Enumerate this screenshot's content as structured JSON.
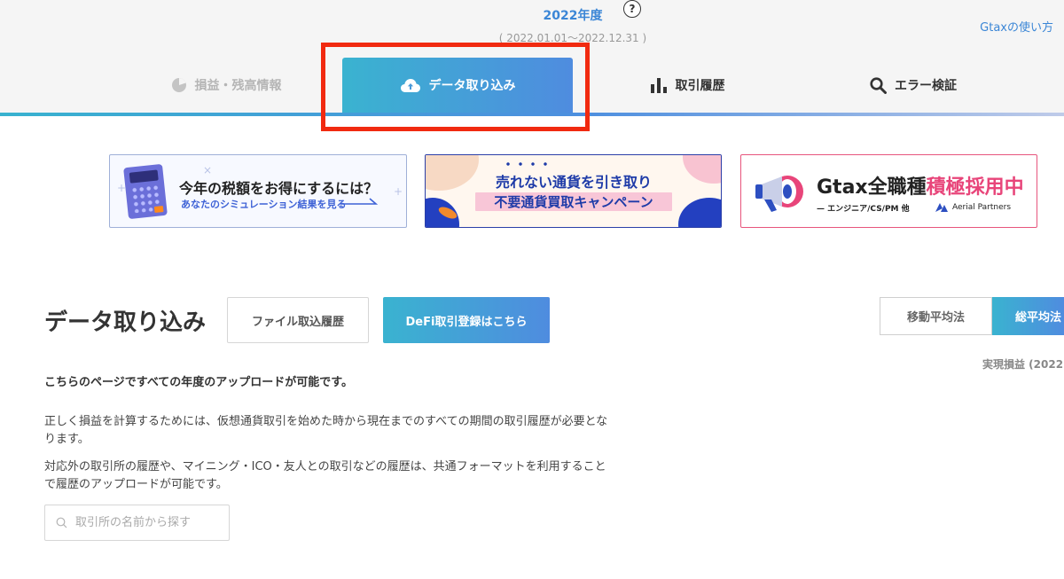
{
  "header": {
    "year_title": "2022年度",
    "year_range": "( 2022.01.01〜2022.12.31 )",
    "help_icon_glyph": "?",
    "guide_link": "Gtaxの使い方"
  },
  "nav_tabs": [
    {
      "label": "損益・残高情報",
      "icon": "pie-chart-icon",
      "active": false
    },
    {
      "label": "データ取り込み",
      "icon": "cloud-upload-icon",
      "active": true
    },
    {
      "label": "取引履歴",
      "icon": "bar-chart-icon",
      "active": false
    },
    {
      "label": "エラー検証",
      "icon": "search-icon",
      "active": false
    }
  ],
  "banners": {
    "tax": {
      "title": "今年の税額をお得にするには？",
      "subtitle": "あなたのシミュレーション結果を見る",
      "calc_key": "AC"
    },
    "campaign": {
      "title": "売れない通貨を引き取り",
      "subtitle": "不要通貨買取キャンペーン"
    },
    "recruit": {
      "brand": "Gtax",
      "title_plain": "全職種",
      "title_accent": "積極採用中",
      "subtitle": "— エンジニア/CS/PM 他",
      "partner": "Aerial Partners"
    }
  },
  "main": {
    "page_title": "データ取り込み",
    "history_button": "ファイル取込履歴",
    "defi_button": "DeFi取引登録はこちら",
    "methods": {
      "moving_average": "移動平均法",
      "total_average": "総平均法"
    },
    "realized_label": "実現損益 (2022",
    "lead": "こちらのページですべての年度のアップロードが可能です。",
    "para1": "正しく損益を計算するためには、仮想通貨取引を始めた時から現在までのすべての期間の取引履歴が必要となります。",
    "para2": "対応外の取引所の履歴や、マイニング・ICO・友人との取引などの履歴は、共通フォーマットを利用することで履歴のアップロードが可能です。",
    "search_placeholder": "取引所の名前から探す"
  },
  "colors": {
    "accent_blue": "#3b86d6",
    "gradient_start": "#3ab3d0",
    "gradient_end": "#4f8cdf",
    "highlight_red": "#f12a10",
    "recruit_pink": "#e8457a"
  }
}
